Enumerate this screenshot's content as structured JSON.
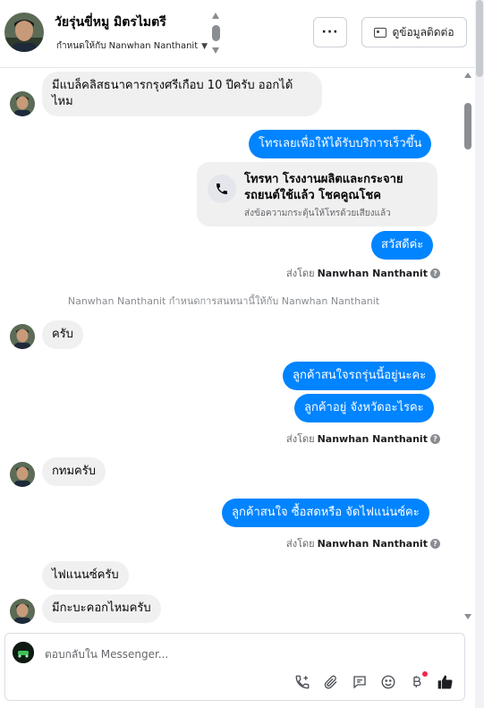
{
  "header": {
    "contact_name": "วัยรุ่นขี่หมู มิตรไมตรี",
    "assigned_to": "กำหนดให้กับ Nanwhan Nanthanit",
    "more_label": "···",
    "contact_info_label": "ดูข้อมูลติดต่อ"
  },
  "messages": {
    "m1": "มีแบล็คลิสธนาคารกรุงศรีเกือบ 10 ปีครับ ออกได้",
    "m1b": "ไหม",
    "m2": "โทรเลยเพื่อให้ได้รับบริการเร็วขึ้น",
    "call_title_1": "โทรหา โรงงานผลิตและกระจาย",
    "call_title_2": "รถยนต์ใช้แล้ว โชคคูณโชค",
    "call_sub": "ส่งข้อความกระตุ้นให้โทรด้วยเสียงแล้ว",
    "m3": "สวัสดีค่ะ",
    "sent_by_prefix": "ส่งโดย",
    "sent_by_name": "Nanwhan Nanthanit",
    "system_line": "Nanwhan Nanthanit กำหนดการสนทนานี้ให้กับ Nanwhan Nanthanit",
    "m4": "ครับ",
    "m5": "ลูกค้าสนใจรถรุ่นนี้อยู่นะคะ",
    "m6": "ลูกค้าอยู่ จังหวัดอะไรคะ",
    "m7": "กทมครับ",
    "m8": "ลูกค้าสนใจ ซื้อสดหรือ จัดไฟแน่นซ์คะ",
    "m9": "ไฟแนนซ์ครับ",
    "m10": "มีกะบะคอกไหมครับ"
  },
  "composer": {
    "placeholder": "ตอบกลับใน Messenger..."
  },
  "colors": {
    "accent": "#0084ff",
    "incoming_bubble": "#f0f0f0"
  },
  "icons": [
    "call-add-icon",
    "attachment-icon",
    "saved-reply-icon",
    "emoji-icon",
    "baht-payment-icon",
    "thumbs-up-icon",
    "phone-icon",
    "question-icon"
  ]
}
